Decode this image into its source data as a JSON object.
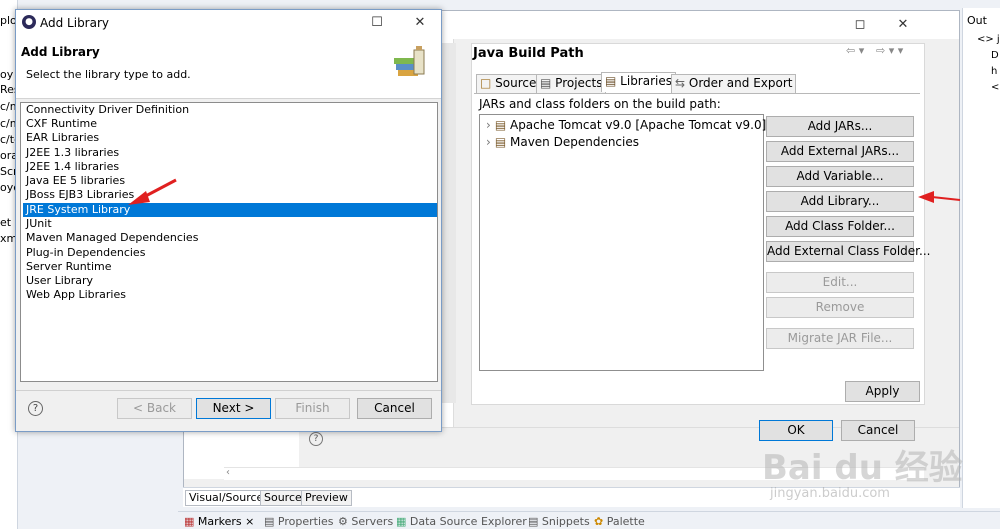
{
  "ide": {
    "left_fragments": [
      "plo",
      "oy",
      "Res",
      "c/m",
      "c/m",
      "c/te",
      "ora",
      "Scri",
      "oye",
      "et",
      "xm"
    ],
    "right_fragments": [
      "Out",
      "<> js",
      "D",
      "h",
      "<"
    ],
    "editor_tabs": [
      "Visual/Source",
      "Source",
      "Preview"
    ],
    "views": [
      "Markers",
      "Properties",
      "Servers",
      "Data Source Explorer",
      "Snippets",
      "Palette"
    ]
  },
  "properties": {
    "title": "Java Build Path",
    "tabs": [
      "Source",
      "Projects",
      "Libraries",
      "Order and Export"
    ],
    "selected_tab": "Libraries",
    "list_label": "JARs and class folders on the build path:",
    "tree_items": [
      "Apache Tomcat v9.0 [Apache Tomcat v9.0]",
      "Maven Dependencies"
    ],
    "buttons": {
      "add_jars": "Add JARs...",
      "add_external_jars": "Add External JARs...",
      "add_variable": "Add Variable...",
      "add_library": "Add Library...",
      "add_class_folder": "Add Class Folder...",
      "add_external_class_folder": "Add External Class Folder...",
      "edit": "Edit...",
      "remove": "Remove",
      "migrate_jar": "Migrate JAR File...",
      "apply": "Apply",
      "ok": "OK",
      "cancel": "Cancel"
    }
  },
  "dialog": {
    "title": "Add Library",
    "heading": "Add Library",
    "subheading": "Select the library type to add.",
    "items": [
      "Connectivity Driver Definition",
      "CXF Runtime",
      "EAR Libraries",
      "J2EE 1.3 libraries",
      "J2EE 1.4 libraries",
      "Java EE 5 libraries",
      "JBoss EJB3 Libraries",
      "JRE System Library",
      "JUnit",
      "Maven Managed Dependencies",
      "Plug-in Dependencies",
      "Server Runtime",
      "User Library",
      "Web App Libraries"
    ],
    "selected_item": "JRE System Library",
    "buttons": {
      "back": "< Back",
      "next": "Next >",
      "finish": "Finish",
      "cancel": "Cancel"
    }
  },
  "watermark": {
    "brand": "Bai du 经验",
    "url": "jingyan.baidu.com"
  },
  "colors": {
    "selection": "#0078d7",
    "annotation_arrow": "#e02020"
  }
}
